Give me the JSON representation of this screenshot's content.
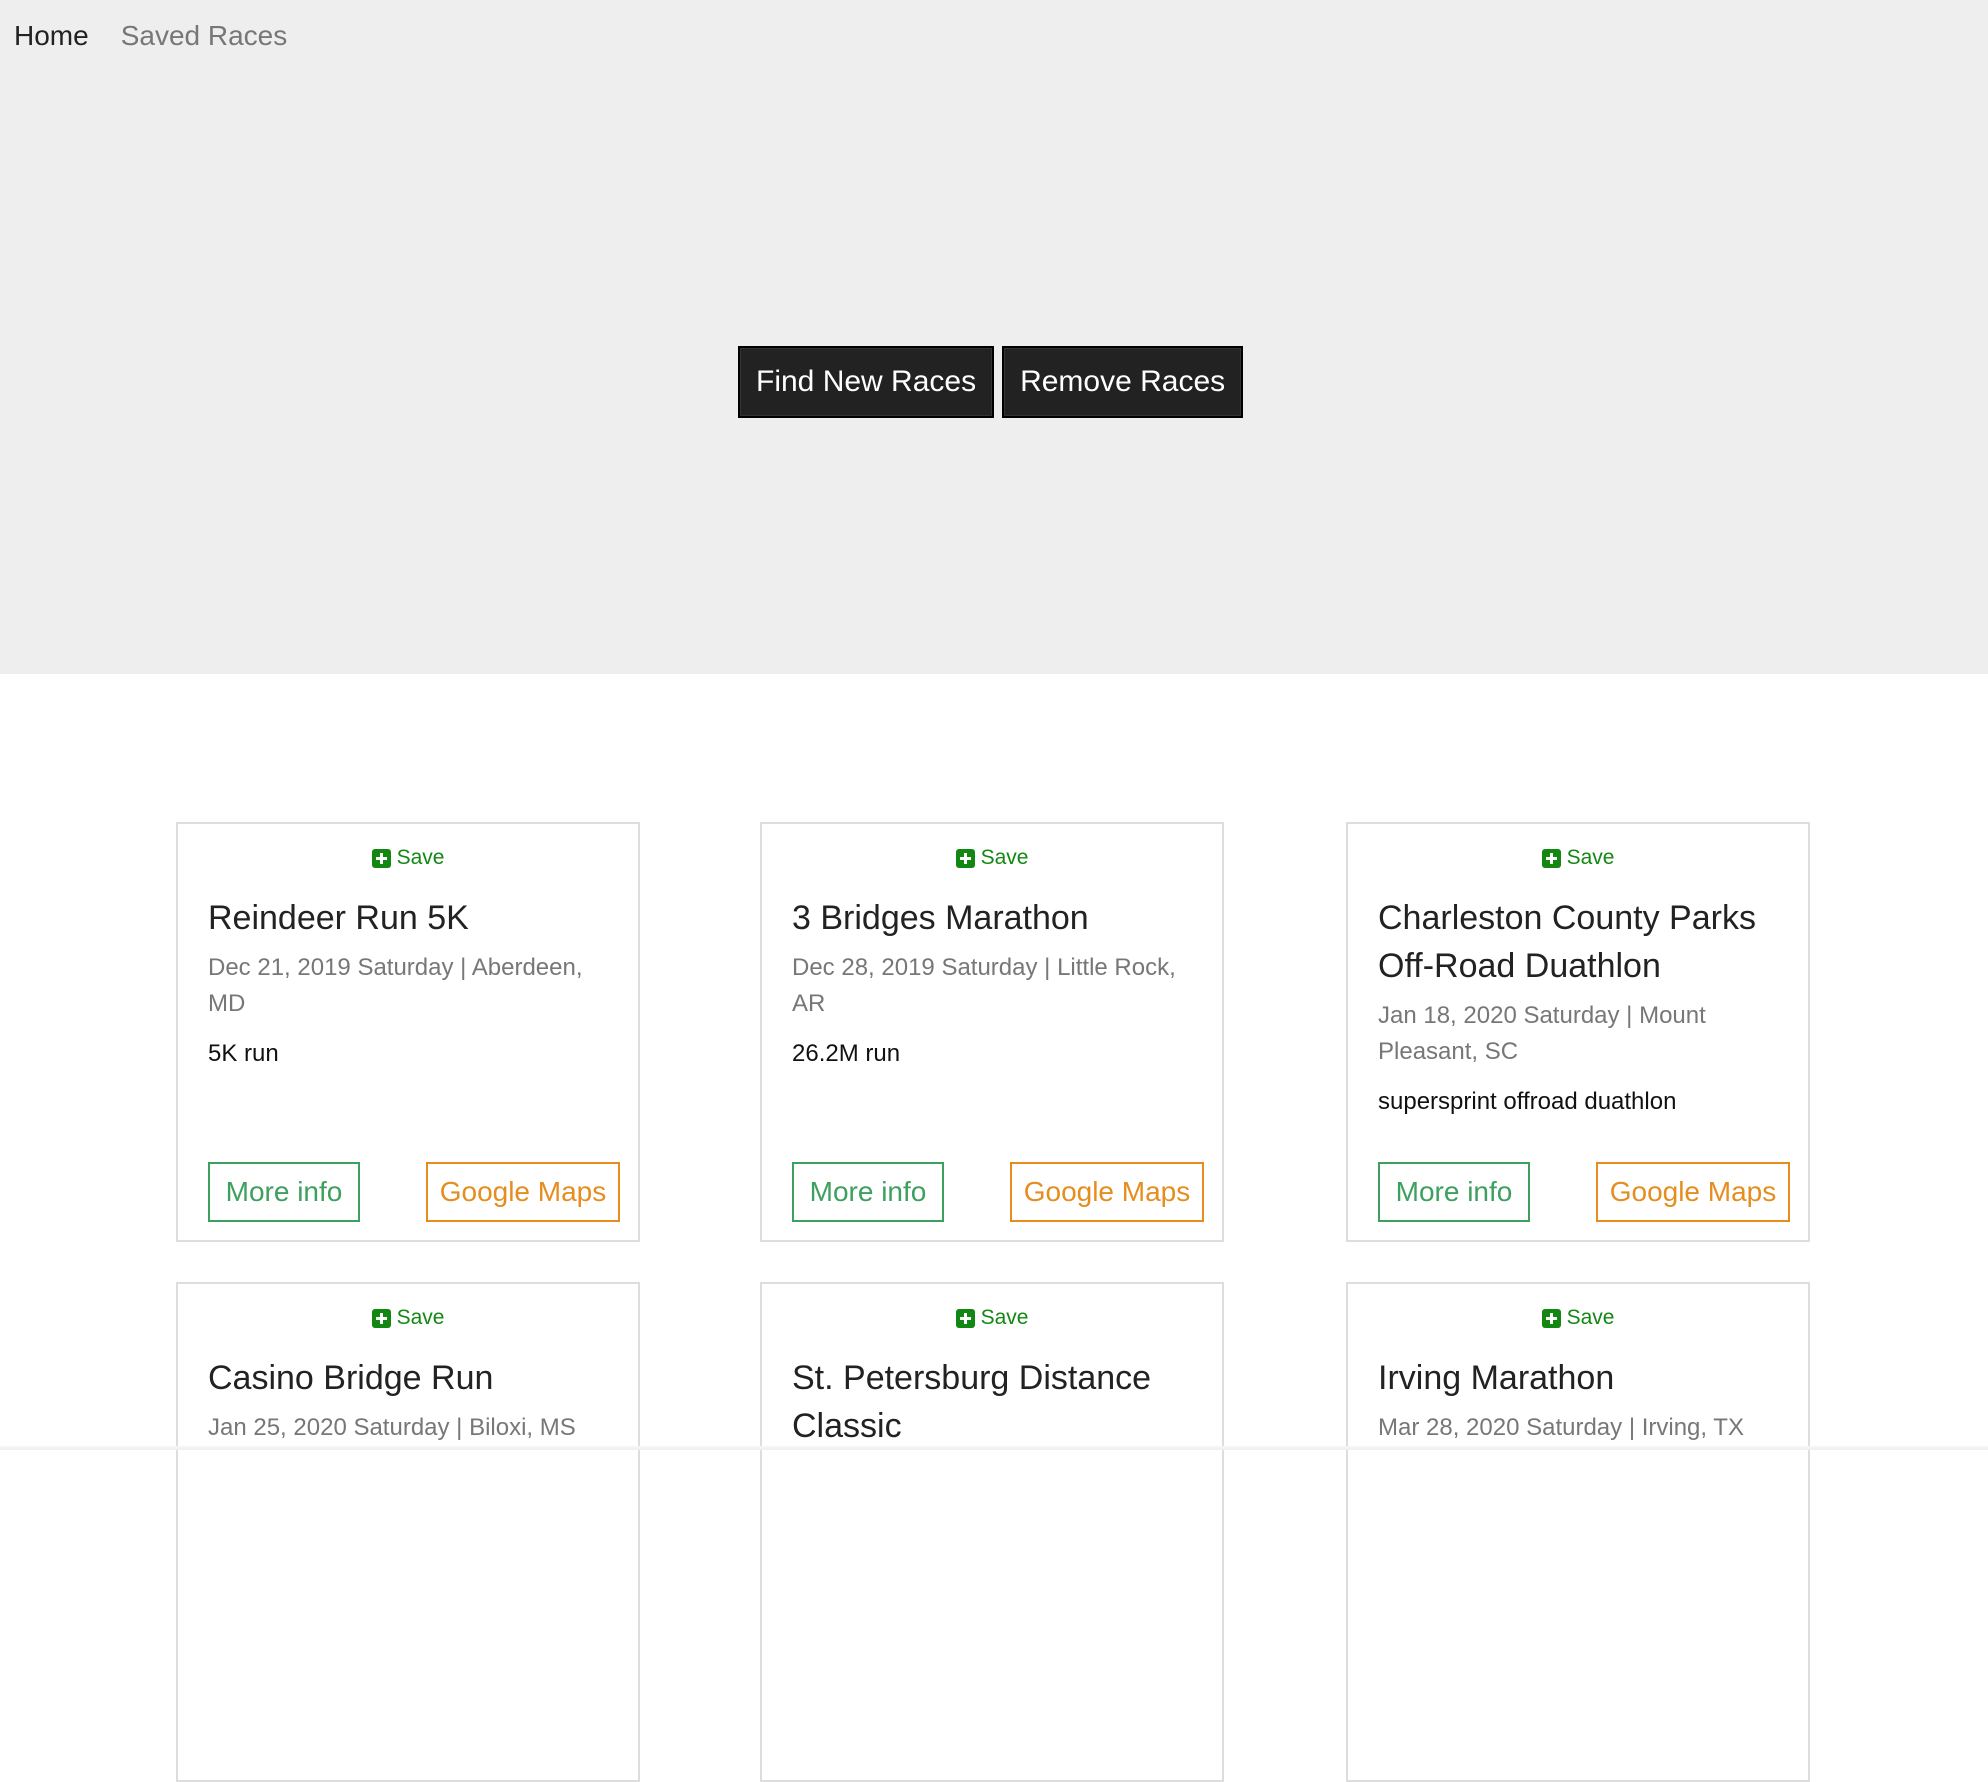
{
  "nav": {
    "items": [
      {
        "label": "Home",
        "active": true
      },
      {
        "label": "Saved Races",
        "active": false
      }
    ]
  },
  "hero": {
    "find_label": "Find New Races",
    "remove_label": "Remove Races"
  },
  "colors": {
    "hero_bg": "#eeeeee",
    "save_green": "#128712",
    "more_info_green": "#3ea05e",
    "maps_orange": "#e58e1f",
    "dark_button": "#222222"
  },
  "races": [
    {
      "save_label": "Save",
      "name": "Reindeer Run 5K",
      "date_location": "Dec 21, 2019 Saturday | Aberdeen, MD",
      "type": "5K run",
      "more_info_label": "More info",
      "maps_label": "Google Maps"
    },
    {
      "save_label": "Save",
      "name": "3 Bridges Marathon",
      "date_location": "Dec 28, 2019 Saturday | Little Rock, AR",
      "type": "26.2M run",
      "more_info_label": "More info",
      "maps_label": "Google Maps"
    },
    {
      "save_label": "Save",
      "name": "Charleston County Parks Off-Road Duathlon",
      "date_location": "Jan 18, 2020 Saturday | Mount Pleasant, SC",
      "type": "supersprint offroad duathlon",
      "more_info_label": "More info",
      "maps_label": "Google Maps"
    },
    {
      "save_label": "Save",
      "name": "Casino Bridge Run",
      "date_location": "Jan 25, 2020 Saturday | Biloxi, MS"
    },
    {
      "save_label": "Save",
      "name": "St. Petersburg Distance Classic",
      "date_location": ""
    },
    {
      "save_label": "Save",
      "name": "Irving Marathon",
      "date_location": "Mar 28, 2020 Saturday | Irving, TX"
    }
  ]
}
